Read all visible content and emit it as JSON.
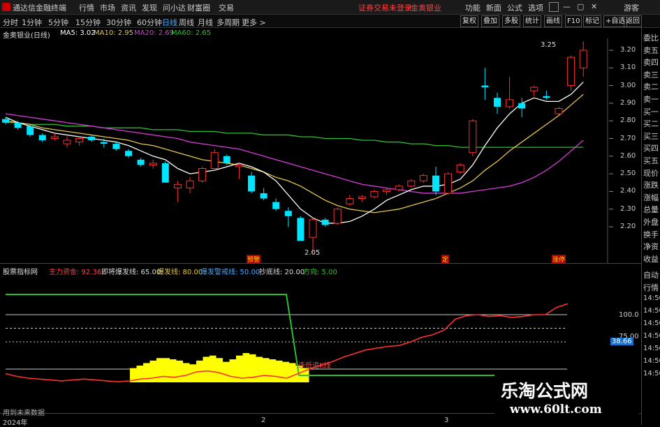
{
  "menu": {
    "app_title": "通达信金融终端",
    "items": [
      "行情",
      "市场",
      "资讯",
      "发现",
      "问小达",
      "财富圈",
      "交易"
    ],
    "login_notice": "证券交易未登录",
    "stock_label": "金奥银业",
    "right_items": [
      "功能",
      "新面",
      "公式",
      "选项",
      "游客"
    ]
  },
  "toolbar": {
    "periods": [
      "分时",
      "1分钟",
      "5分钟",
      "15分钟",
      "30分钟",
      "60分钟",
      "日线",
      "周线",
      "月线",
      "多周期",
      "更多 >"
    ],
    "active_period": "日线",
    "buttons": [
      "复权",
      "叠加",
      "多股",
      "统计",
      "画线",
      "F10",
      "标记",
      "+自选",
      "返回"
    ]
  },
  "price_header": {
    "name": "金奥银业(日线)",
    "ma5": "MA5: 3.02",
    "ma10": "MA10: 2.95",
    "ma20": "MA20: 2.69",
    "ma60": "MA60: 2.65"
  },
  "price_axis": [
    "3.20",
    "3.10",
    "3.00",
    "2.90",
    "2.80",
    "2.70",
    "2.60",
    "2.50",
    "2.40",
    "2.30",
    "2.20"
  ],
  "annotations": {
    "high": "3.25",
    "low": "2.05",
    "tag1": "预警",
    "tag2": "定",
    "tag3": "涨停"
  },
  "indicator_header": {
    "name": "股票指标网",
    "l1": "主力资金: 92.36",
    "l2": "即将爆发线: 65.00",
    "l3": "爆发线: 80.00",
    "l4": "爆发警戒线: 50.00",
    "l5": "抄底线: 20.00",
    "l6": "方向: 5.00"
  },
  "indicator_axis": {
    "v1": "100.0",
    "v2": "75.00",
    "v3": "38.66"
  },
  "indicator_label": "连低追K线",
  "right_sidebar": [
    "委比",
    "卖五",
    "卖四",
    "卖三",
    "卖二",
    "卖一",
    "买一",
    "买二",
    "买三",
    "买四",
    "买五",
    "现价",
    "涨跌",
    "涨幅",
    "总量",
    "外盘",
    "换手",
    "净资",
    "收益"
  ],
  "right_sidebar2": [
    "自动",
    "行情",
    "14:50",
    "14:50",
    "14:50",
    "14:50",
    "14:50",
    "14:50",
    "14:50"
  ],
  "time_axis": {
    "t0": "2024年",
    "t1": "2",
    "t2": "3"
  },
  "footer_note": "用到未来数据",
  "watermark": {
    "line1": "乐淘公式网",
    "line2": "www.60lt.com"
  },
  "colors": {
    "up": "#ff3030",
    "down": "#00e5ff",
    "ma5": "#ffffff",
    "ma10": "#e6c84a",
    "ma20": "#d63cd6",
    "ma60": "#2ec02e"
  },
  "chart_data": [
    {
      "type": "candlestick",
      "title": "金奥银业(日线)",
      "ylim": [
        2.1,
        3.3
      ],
      "ohlc": [
        [
          2.81,
          2.82,
          2.78,
          2.79
        ],
        [
          2.79,
          2.8,
          2.75,
          2.76
        ],
        [
          2.77,
          2.78,
          2.71,
          2.72
        ],
        [
          2.72,
          2.73,
          2.68,
          2.69
        ],
        [
          2.7,
          2.73,
          2.69,
          2.71
        ],
        [
          2.67,
          2.71,
          2.65,
          2.69
        ],
        [
          2.68,
          2.71,
          2.66,
          2.7
        ],
        [
          2.71,
          2.72,
          2.68,
          2.69
        ],
        [
          2.68,
          2.7,
          2.65,
          2.67
        ],
        [
          2.67,
          2.68,
          2.63,
          2.64
        ],
        [
          2.63,
          2.64,
          2.59,
          2.6
        ],
        [
          2.58,
          2.59,
          2.54,
          2.55
        ],
        [
          2.55,
          2.58,
          2.53,
          2.56
        ],
        [
          2.56,
          2.57,
          2.45,
          2.45
        ],
        [
          2.42,
          2.46,
          2.34,
          2.44
        ],
        [
          2.42,
          2.48,
          2.39,
          2.46
        ],
        [
          2.46,
          2.54,
          2.45,
          2.53
        ],
        [
          2.53,
          2.64,
          2.52,
          2.62
        ],
        [
          2.6,
          2.61,
          2.55,
          2.56
        ],
        [
          2.54,
          2.56,
          2.47,
          2.55
        ],
        [
          2.49,
          2.51,
          2.39,
          2.4
        ],
        [
          2.39,
          2.42,
          2.35,
          2.36
        ],
        [
          2.34,
          2.36,
          2.29,
          2.3
        ],
        [
          2.29,
          2.31,
          2.2,
          2.26
        ],
        [
          2.25,
          2.26,
          2.15,
          2.12
        ],
        [
          2.14,
          2.25,
          2.05,
          2.24
        ],
        [
          2.24,
          2.25,
          2.2,
          2.21
        ],
        [
          2.22,
          2.31,
          2.21,
          2.3
        ],
        [
          2.33,
          2.38,
          2.32,
          2.36
        ],
        [
          2.36,
          2.38,
          2.34,
          2.37
        ],
        [
          2.37,
          2.41,
          2.36,
          2.4
        ],
        [
          2.4,
          2.42,
          2.38,
          2.41
        ],
        [
          2.41,
          2.44,
          2.4,
          2.43
        ],
        [
          2.43,
          2.47,
          2.42,
          2.46
        ],
        [
          2.46,
          2.5,
          2.45,
          2.49
        ],
        [
          2.49,
          2.54,
          2.38,
          2.4
        ],
        [
          2.39,
          2.51,
          2.38,
          2.5
        ],
        [
          2.51,
          2.56,
          2.5,
          2.55
        ],
        [
          2.62,
          2.81,
          2.6,
          2.8
        ],
        [
          3.0,
          3.1,
          2.92,
          2.99
        ],
        [
          2.93,
          2.96,
          2.84,
          2.88
        ],
        [
          2.88,
          3.05,
          2.87,
          2.92
        ],
        [
          2.9,
          2.93,
          2.82,
          2.87
        ],
        [
          2.97,
          3.0,
          2.94,
          2.99
        ],
        [
          2.94,
          2.97,
          2.92,
          2.93
        ],
        [
          2.84,
          2.88,
          2.83,
          2.87
        ],
        [
          3.0,
          3.17,
          2.97,
          3.16
        ],
        [
          3.1,
          3.25,
          3.05,
          3.2
        ]
      ],
      "ma5": [
        2.82,
        2.79,
        2.77,
        2.75,
        2.73,
        2.72,
        2.71,
        2.7,
        2.69,
        2.68,
        2.66,
        2.63,
        2.6,
        2.58,
        2.53,
        2.5,
        2.51,
        2.52,
        2.54,
        2.56,
        2.54,
        2.51,
        2.46,
        2.38,
        2.3,
        2.25,
        2.22,
        2.22,
        2.23,
        2.26,
        2.3,
        2.35,
        2.38,
        2.41,
        2.43,
        2.43,
        2.44,
        2.47,
        2.55,
        2.66,
        2.76,
        2.84,
        2.9,
        2.93,
        2.91,
        2.91,
        2.95,
        3.02
      ],
      "ma10": [
        2.8,
        2.79,
        2.78,
        2.76,
        2.75,
        2.74,
        2.73,
        2.72,
        2.71,
        2.7,
        2.69,
        2.67,
        2.66,
        2.64,
        2.62,
        2.6,
        2.58,
        2.57,
        2.56,
        2.55,
        2.53,
        2.51,
        2.48,
        2.46,
        2.43,
        2.39,
        2.35,
        2.32,
        2.3,
        2.29,
        2.28,
        2.29,
        2.3,
        2.32,
        2.34,
        2.36,
        2.39,
        2.42,
        2.46,
        2.52,
        2.57,
        2.63,
        2.68,
        2.73,
        2.78,
        2.83,
        2.89,
        2.95
      ],
      "ma20": [
        2.84,
        2.83,
        2.82,
        2.81,
        2.8,
        2.79,
        2.78,
        2.77,
        2.76,
        2.75,
        2.74,
        2.73,
        2.72,
        2.71,
        2.7,
        2.68,
        2.67,
        2.66,
        2.65,
        2.64,
        2.62,
        2.6,
        2.58,
        2.56,
        2.54,
        2.52,
        2.5,
        2.48,
        2.46,
        2.44,
        2.43,
        2.42,
        2.41,
        2.4,
        2.39,
        2.39,
        2.39,
        2.39,
        2.4,
        2.41,
        2.42,
        2.43,
        2.45,
        2.48,
        2.52,
        2.57,
        2.63,
        2.69
      ],
      "ma60": [
        2.79,
        2.79,
        2.78,
        2.78,
        2.78,
        2.77,
        2.77,
        2.77,
        2.76,
        2.76,
        2.76,
        2.76,
        2.75,
        2.75,
        2.75,
        2.74,
        2.74,
        2.74,
        2.73,
        2.73,
        2.73,
        2.72,
        2.72,
        2.72,
        2.71,
        2.71,
        2.7,
        2.7,
        2.7,
        2.69,
        2.69,
        2.68,
        2.68,
        2.67,
        2.67,
        2.66,
        2.66,
        2.65,
        2.65,
        2.65,
        2.65,
        2.65,
        2.65,
        2.65,
        2.65,
        2.65,
        2.65,
        2.65
      ]
    },
    {
      "type": "line",
      "title": "股票指标网",
      "ylim": [
        0,
        120
      ],
      "series": [
        {
          "name": "主力资金",
          "values": [
            15,
            12,
            10,
            9,
            8,
            7,
            8,
            9,
            8,
            7,
            6,
            7,
            9,
            10,
            12,
            11,
            13,
            17,
            18,
            16,
            12,
            10,
            11,
            13,
            12,
            10,
            15,
            20,
            24,
            28,
            33,
            37,
            41,
            43,
            45,
            46,
            50,
            55,
            58,
            63,
            75,
            79,
            80,
            78,
            79,
            77,
            78,
            80,
            80,
            88,
            92
          ]
        },
        {
          "name": "即将爆发线",
          "values": [
            65
          ]
        },
        {
          "name": "爆发线",
          "values": [
            80
          ]
        },
        {
          "name": "爆发警戒线",
          "values": [
            50
          ]
        },
        {
          "name": "抄底线",
          "values": [
            20
          ]
        },
        {
          "name": "方向",
          "values": [
            5
          ]
        }
      ],
      "bars": [
        0,
        0,
        0,
        0,
        0,
        0,
        0,
        0,
        0,
        0,
        0,
        0,
        0,
        0,
        0,
        0,
        0,
        8,
        10,
        12,
        14,
        16,
        16,
        15,
        14,
        12,
        11,
        14,
        17,
        18,
        16,
        13,
        15,
        18,
        20,
        19,
        17,
        16,
        15,
        14,
        13,
        12,
        10,
        8
      ]
    }
  ]
}
